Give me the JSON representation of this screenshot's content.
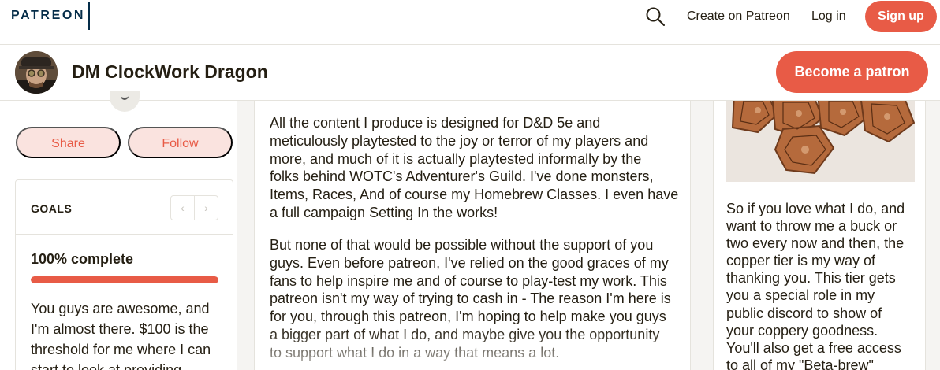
{
  "topnav": {
    "logo": "PATREON",
    "create_label": "Create on Patreon",
    "login_label": "Log in",
    "signup_label": "Sign up"
  },
  "creator": {
    "name": "DM ClockWork Dragon",
    "become_patron_label": "Become a patron"
  },
  "sidebar": {
    "share_label": "Share",
    "follow_label": "Follow",
    "goals": {
      "title": "GOALS",
      "prev_arrow": "‹",
      "next_arrow": "›",
      "percent_label": "100% complete",
      "progress": 1.0,
      "description": "You guys are awesome, and I'm almost there. $100 is the threshold for me where I can start to look at providing"
    }
  },
  "post": {
    "paragraph1": "All the content I produce is designed for D&D 5e and\nmeticulously playtested to the joy or terror of my players and\nmore, and much of it is actually playtested informally by the\nfolks behind WOTC's Adventurer's Guild. I've done monsters,\nItems, Races, And of course my Homebrew Classes. I even have\na full campaign Setting In the works!",
    "paragraph2": "But none of that would be possible without the support of you\nguys. Even before patreon, I've relied on the good graces of my\nfans to help inspire me and of course to play-test my work. This\npatreon isn't my way of trying to cash in - The reason I'm here is\nfor you, through this patreon, I'm hoping to help make you guys\na bigger part of what I do, and maybe give you the opportunity\nto support what I do in a way that means a lot."
  },
  "tier": {
    "description": " So if you love what I do, and\nwant to throw me a buck or\ntwo every now and then, the\ncopper tier is my way of\nthanking you. This tier gets\nyou a special role in my\npublic discord to show of\nyour coppery goodness.\n You'll also get a free access\nto all of my \"Beta-brew\""
  },
  "colors": {
    "brand": "#e85b46",
    "brand_tint": "#fae3df",
    "logo_navy": "#052d49",
    "text": "#241e12",
    "border": "#e5e3dd"
  },
  "icons": {
    "search": "search-icon",
    "avatar": "avatar",
    "coins_image": "copper-coins-image"
  }
}
